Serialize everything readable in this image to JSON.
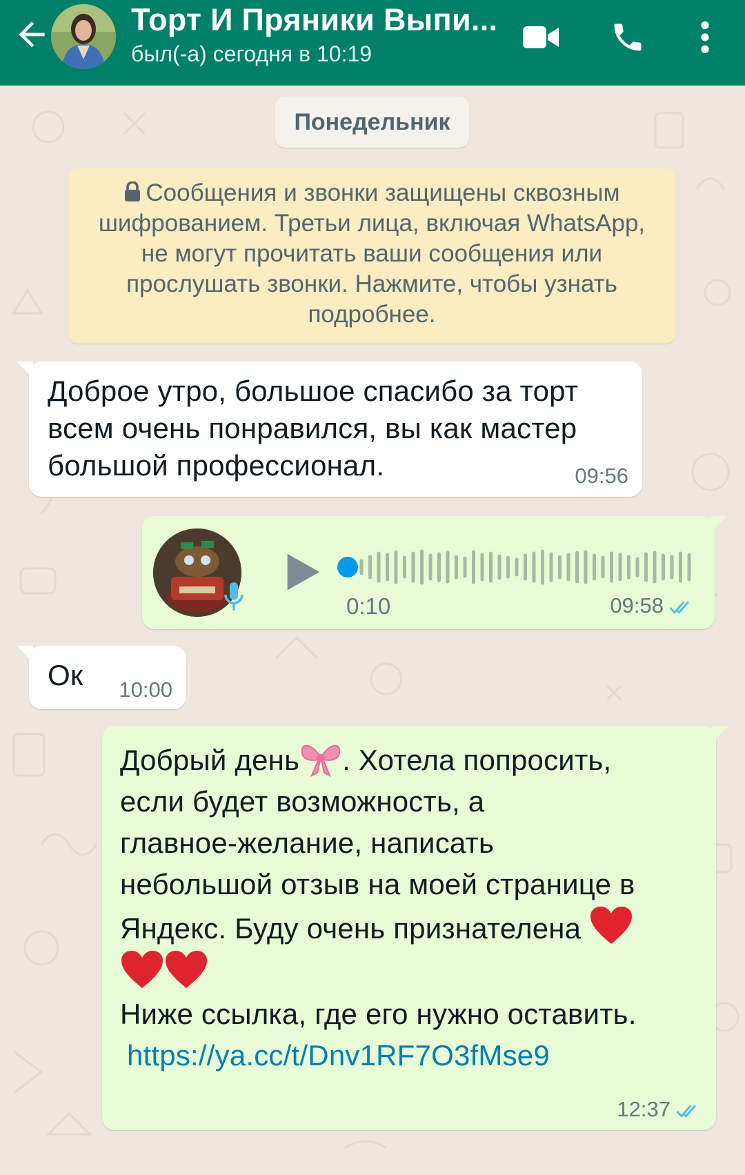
{
  "header": {
    "title": "Торт И Пряники Выпи...",
    "status": "был(-а) сегодня в 10:19",
    "colors": {
      "bar": "#008069"
    },
    "icons": [
      "arrow-back-icon",
      "video-call-icon",
      "phone-icon",
      "more-vert-icon"
    ]
  },
  "chat": {
    "day_chip": "Понедельник",
    "encryption_notice": "Сообщения и звонки защищены сквозным шифрованием. Третьи лица, включая WhatsApp, не могут прочитать ваши сообщения или прослушать звонки. Нажмите, чтобы узнать подробнее.",
    "messages": [
      {
        "direction": "incoming",
        "text": "Доброе утро, большое спасибо за торт всем очень понравился, вы как мастер большой профессионал.",
        "time": "09:56"
      },
      {
        "direction": "outgoing",
        "type": "voice",
        "duration": "0:10",
        "time": "09:58",
        "status": "read"
      },
      {
        "direction": "incoming",
        "text": "Ок",
        "time": "10:00"
      },
      {
        "direction": "outgoing",
        "lines": [
          "Добрый день",
          ".  Хотела попросить,",
          "если будет возможность,  а",
          "главное-желание,  написать",
          "небольшой отзыв на моей странице в",
          "Яндекс.  Буду очень признателена",
          "Ниже ссылка, где его нужно оставить."
        ],
        "emojis": [
          "ribbon-emoji",
          "heart-emoji",
          "heart-emoji",
          "heart-emoji"
        ],
        "link": "https://ya.cc/t/Dnv1RF7O3fMse9",
        "time": "12:37",
        "status": "read"
      }
    ]
  }
}
